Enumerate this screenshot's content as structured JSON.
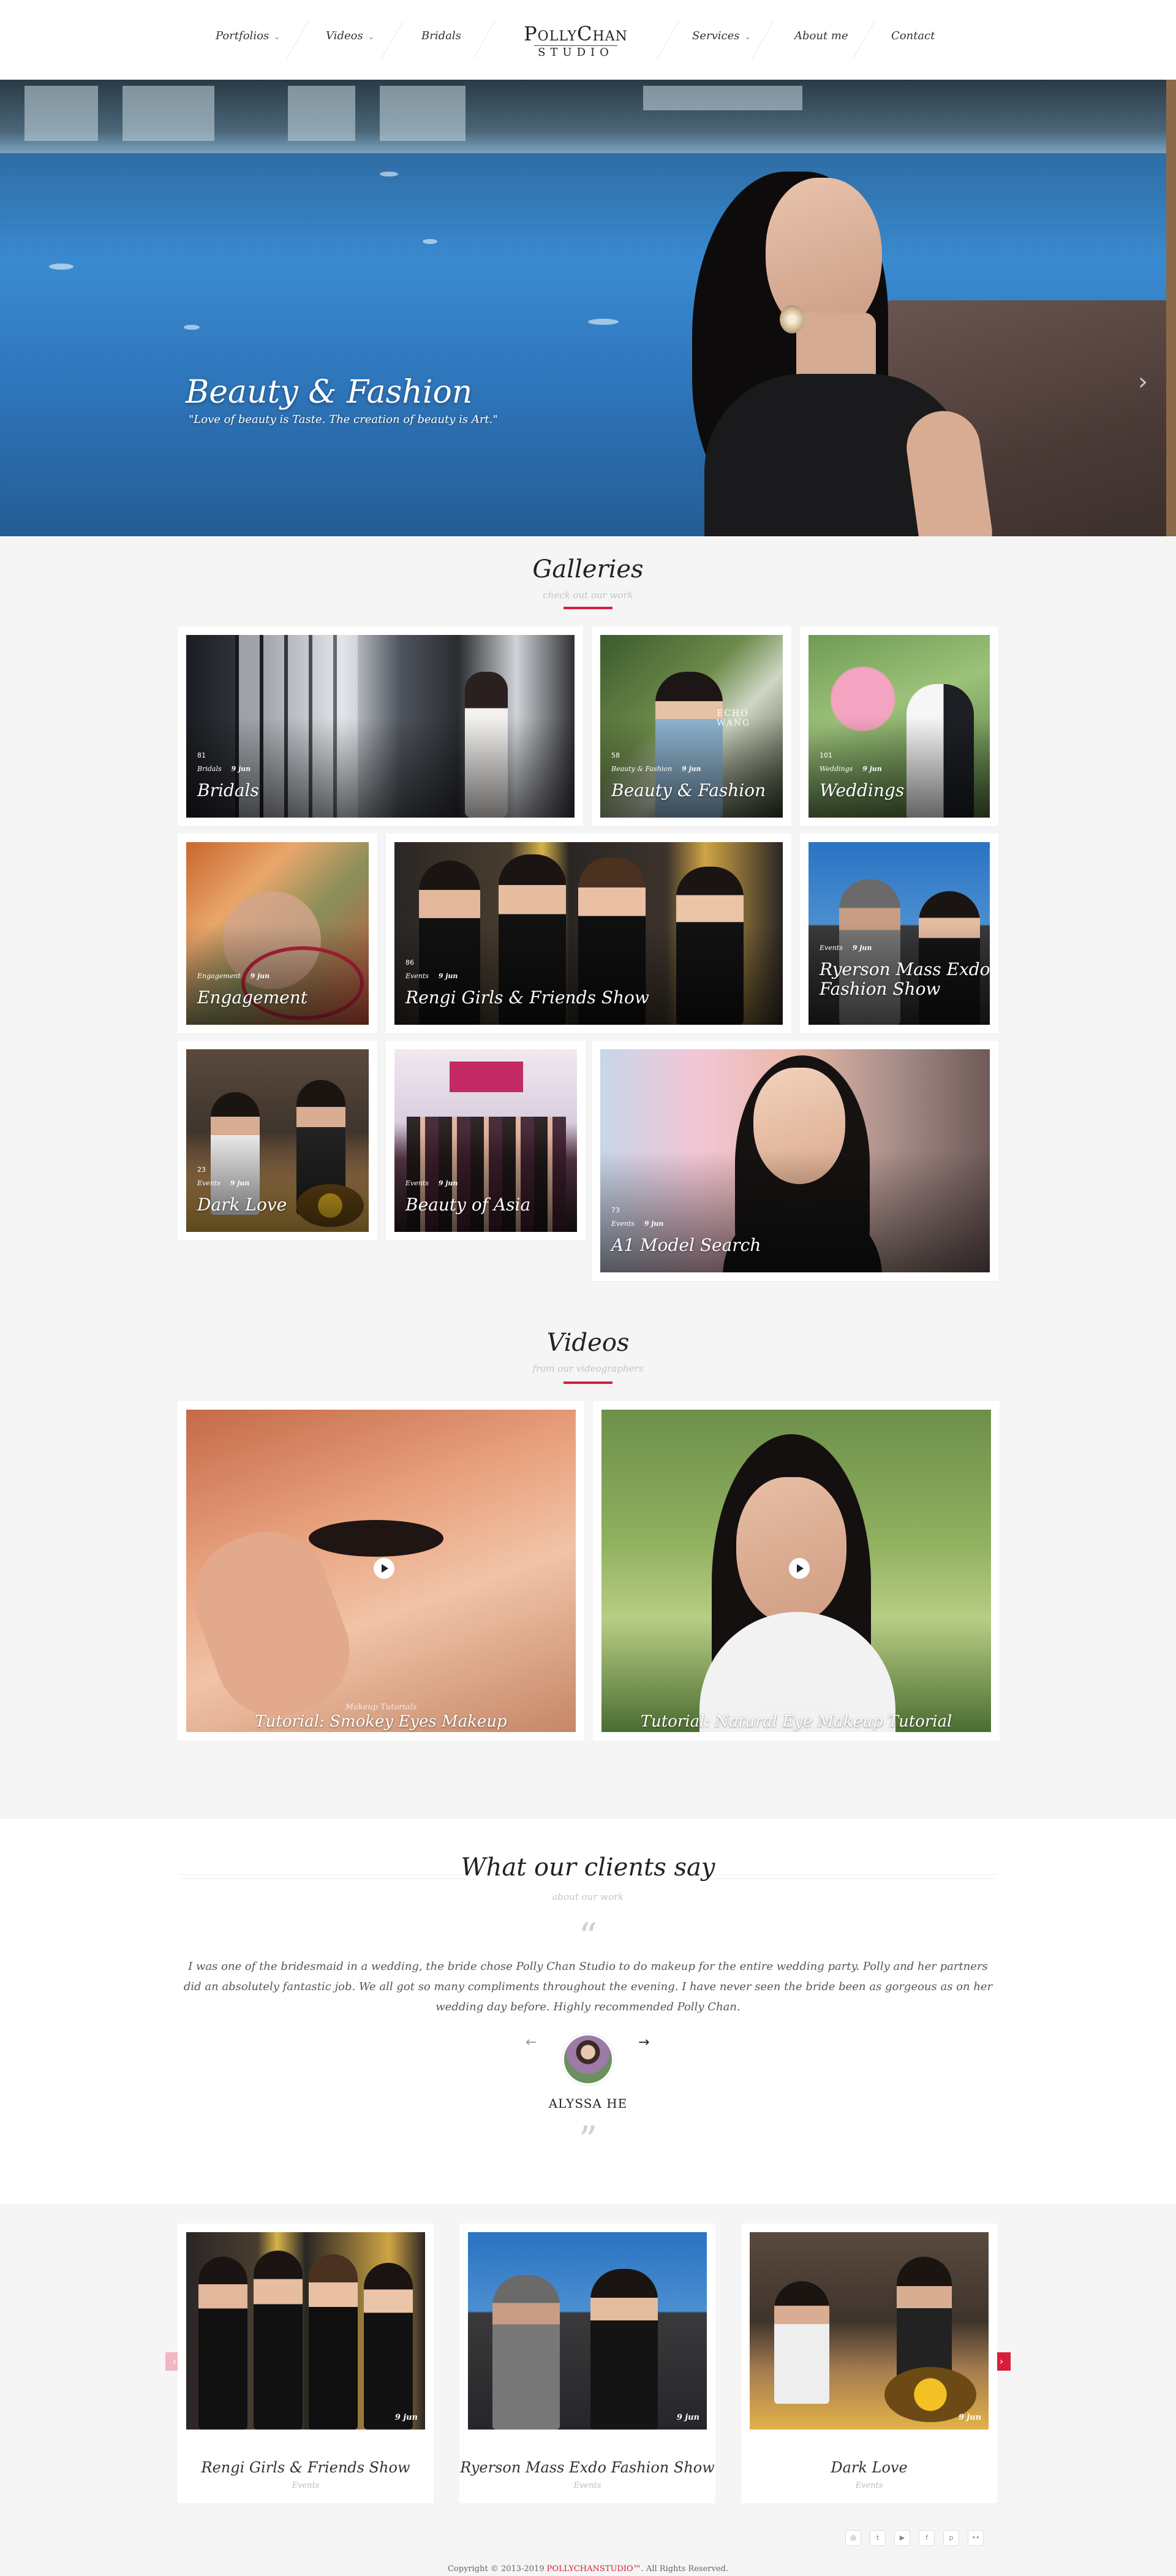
{
  "nav": {
    "items_left": [
      {
        "label": "Portfolios",
        "has_dropdown": true
      },
      {
        "label": "Videos",
        "has_dropdown": true
      },
      {
        "label": "Bridals",
        "has_dropdown": false
      }
    ],
    "items_right": [
      {
        "label": "Services",
        "has_dropdown": true
      },
      {
        "label": "About me",
        "has_dropdown": false
      },
      {
        "label": "Contact",
        "has_dropdown": false
      }
    ],
    "logo_main": "PollyChan",
    "logo_sub": "STUDIO"
  },
  "hero": {
    "title": "Beauty & Fashion",
    "subtitle": "\"Love of beauty is Taste. The creation of beauty is Art.\"",
    "next_arrow": "›"
  },
  "galleries": {
    "title": "Galleries",
    "subtitle": "check out our work",
    "items": [
      {
        "name": "Bridals",
        "count": "81",
        "category": "Bridals",
        "date": "9 jun"
      },
      {
        "name": "Beauty & Fashion",
        "count": "58",
        "category": "Beauty & Fashion",
        "date": "9 jun"
      },
      {
        "name": "Weddings",
        "count": "101",
        "category": "Weddings",
        "date": "9 jun"
      },
      {
        "name": "Engagement",
        "count": "",
        "category": "Engagement",
        "date": "9 jun"
      },
      {
        "name": "Rengi Girls & Friends Show",
        "count": "86",
        "category": "Events",
        "date": "9 jun"
      },
      {
        "name": "Ryerson Mass Exdo Fashion Show",
        "count": "",
        "category": "Events",
        "date": "9 jun"
      },
      {
        "name": "Dark Love",
        "count": "23",
        "category": "Events",
        "date": "9 jun"
      },
      {
        "name": "Beauty of Asia",
        "count": "",
        "category": "Events",
        "date": "9 jun"
      },
      {
        "name": "A1 Model Search",
        "count": "73",
        "category": "Events",
        "date": "9 jun"
      }
    ]
  },
  "videos": {
    "title": "Videos",
    "subtitle": "from our videographers",
    "items": [
      {
        "title": "Tutorial: Smokey Eyes Makeup",
        "category": "Makeup Tutorials"
      },
      {
        "title": "Tutorial: Natural Eye Makeup Tutorial",
        "category": "Makeup Tutorials"
      }
    ]
  },
  "testimonials": {
    "title": "What our clients say",
    "subtitle": "about our work",
    "quote": "I was one of the bridesmaid in a wedding, the bride chose Polly Chan Studio to do makeup for the entire wedding party. Polly and her partners did an absolutely fantastic job. We all got so many compliments throughout the evening. I have never seen the bride been as gorgeous as on her wedding day before. Highly recommended Polly Chan.",
    "client_name": "ALYSSA HE",
    "prev_arrow": "←",
    "next_arrow": "→",
    "open_quote": "“",
    "close_quote": "”"
  },
  "events_carousel": {
    "prev_arrow": "‹",
    "next_arrow": "›",
    "items": [
      {
        "title": "Rengi Girls & Friends Show",
        "category": "Events",
        "date": "9 jun"
      },
      {
        "title": "Ryerson Mass Exdo Fashion Show",
        "category": "Events",
        "date": "9 jun"
      },
      {
        "title": "Dark Love",
        "category": "Events",
        "date": "9 jun"
      }
    ]
  },
  "footer": {
    "social": [
      {
        "icon": "instagram-icon",
        "glyph": "◎"
      },
      {
        "icon": "twitter-icon",
        "glyph": "t"
      },
      {
        "icon": "youtube-icon",
        "glyph": "▶"
      },
      {
        "icon": "facebook-icon",
        "glyph": "f"
      },
      {
        "icon": "pinterest-icon",
        "glyph": "p"
      },
      {
        "icon": "flickr-icon",
        "glyph": "••"
      }
    ],
    "copyright_prefix": "Copyright © 2013-2019 ",
    "copyright_brand": "POLLYCHANSTUDIO™",
    "copyright_suffix": ". All Rights Reserved."
  },
  "colors": {
    "accent": "#d81e3a",
    "background": "#f5f5f5",
    "card": "#ffffff"
  }
}
